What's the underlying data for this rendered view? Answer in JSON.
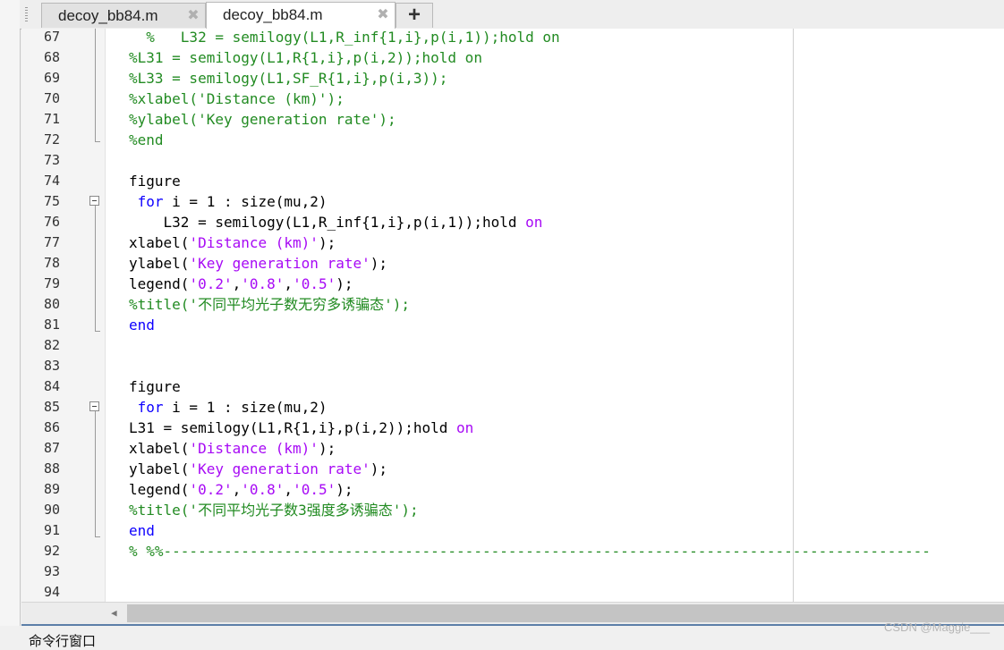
{
  "tabs": [
    {
      "label": "decoy_bb84.m",
      "close": "✖"
    },
    {
      "label": "decoy_bb84.m",
      "close": "✖"
    }
  ],
  "new_tab": "+",
  "lines": [
    {
      "n": "67",
      "segs": [
        [
          "cmt",
          "  %   L32 = semilogy(L1,R_inf{1,i},p(i,1));hold on"
        ]
      ]
    },
    {
      "n": "68",
      "segs": [
        [
          "cmt",
          "%L31 = semilogy(L1,R{1,i},p(i,2));hold on"
        ]
      ]
    },
    {
      "n": "69",
      "segs": [
        [
          "cmt",
          "%L33 = semilogy(L1,SF_R{1,i},p(i,3));"
        ]
      ]
    },
    {
      "n": "70",
      "segs": [
        [
          "cmt",
          "%xlabel('Distance (km)');"
        ]
      ]
    },
    {
      "n": "71",
      "segs": [
        [
          "cmt",
          "%ylabel('Key generation rate');"
        ]
      ]
    },
    {
      "n": "72",
      "segs": [
        [
          "cmt",
          "%end"
        ]
      ]
    },
    {
      "n": "73",
      "segs": []
    },
    {
      "n": "74",
      "segs": [
        [
          "",
          "figure"
        ]
      ]
    },
    {
      "n": "75",
      "segs": [
        [
          "kw",
          " for"
        ],
        [
          "",
          " i = 1 : size(mu,2)"
        ]
      ]
    },
    {
      "n": "76",
      "segs": [
        [
          "",
          "    L32 = semilogy(L1,R_inf{1,i},p(i,1));hold "
        ],
        [
          "str",
          "on"
        ]
      ]
    },
    {
      "n": "77",
      "segs": [
        [
          "",
          "xlabel("
        ],
        [
          "str",
          "'Distance (km)'"
        ],
        [
          "",
          ");"
        ]
      ]
    },
    {
      "n": "78",
      "segs": [
        [
          "",
          "ylabel("
        ],
        [
          "str",
          "'Key generation rate'"
        ],
        [
          "",
          ");"
        ]
      ]
    },
    {
      "n": "79",
      "segs": [
        [
          "",
          "legend("
        ],
        [
          "str",
          "'0.2'"
        ],
        [
          "",
          ","
        ],
        [
          "str",
          "'0.8'"
        ],
        [
          "",
          ","
        ],
        [
          "str",
          "'0.5'"
        ],
        [
          "",
          ");"
        ]
      ]
    },
    {
      "n": "80",
      "segs": [
        [
          "cmt",
          "%title('不同平均光子数无穷多诱骗态');"
        ]
      ]
    },
    {
      "n": "81",
      "segs": [
        [
          "kw",
          "end"
        ]
      ]
    },
    {
      "n": "82",
      "segs": []
    },
    {
      "n": "83",
      "segs": []
    },
    {
      "n": "84",
      "segs": [
        [
          "",
          "figure"
        ]
      ]
    },
    {
      "n": "85",
      "segs": [
        [
          "kw",
          " for"
        ],
        [
          "",
          " i = 1 : size(mu,2)"
        ]
      ]
    },
    {
      "n": "86",
      "segs": [
        [
          "",
          "L31 = semilogy(L1,R{1,i},p(i,2));hold "
        ],
        [
          "str",
          "on"
        ]
      ]
    },
    {
      "n": "87",
      "segs": [
        [
          "",
          "xlabel("
        ],
        [
          "str",
          "'Distance (km)'"
        ],
        [
          "",
          ");"
        ]
      ]
    },
    {
      "n": "88",
      "segs": [
        [
          "",
          "ylabel("
        ],
        [
          "str",
          "'Key generation rate'"
        ],
        [
          "",
          ");"
        ]
      ]
    },
    {
      "n": "89",
      "segs": [
        [
          "",
          "legend("
        ],
        [
          "str",
          "'0.2'"
        ],
        [
          "",
          ","
        ],
        [
          "str",
          "'0.8'"
        ],
        [
          "",
          ","
        ],
        [
          "str",
          "'0.5'"
        ],
        [
          "",
          ");"
        ]
      ]
    },
    {
      "n": "90",
      "segs": [
        [
          "cmt",
          "%title('不同平均光子数3强度多诱骗态');"
        ]
      ]
    },
    {
      "n": "91",
      "segs": [
        [
          "kw",
          "end"
        ]
      ]
    },
    {
      "n": "92",
      "segs": [
        [
          "cmt",
          "% %%-----------------------------------------------------------------------------------------"
        ]
      ]
    },
    {
      "n": "93",
      "segs": []
    },
    {
      "n": "94",
      "segs": []
    }
  ],
  "bottom_panel": {
    "title": "命令行窗口"
  },
  "watermark": "CSDN @Maggie___",
  "colors": {
    "keyword": "#0e00ff",
    "string": "#a709f5",
    "comment": "#228b22"
  }
}
